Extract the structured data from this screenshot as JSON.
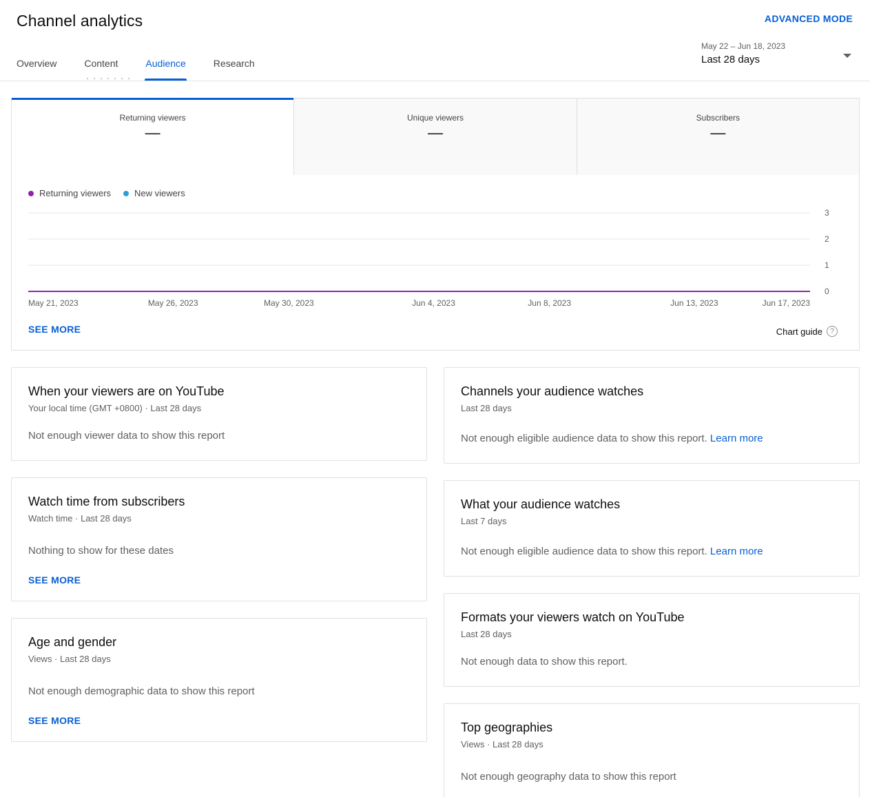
{
  "header": {
    "title": "Channel analytics",
    "advanced_mode": "ADVANCED MODE",
    "tabs": [
      "Overview",
      "Content",
      "Audience",
      "Research"
    ],
    "active_tab": "Audience",
    "date_range": "May 22 – Jun 18, 2023",
    "date_label": "Last 28 days"
  },
  "metrics": [
    {
      "label": "Returning viewers",
      "value": "—"
    },
    {
      "label": "Unique viewers",
      "value": "—"
    },
    {
      "label": "Subscribers",
      "value": "—"
    }
  ],
  "chart_data": {
    "type": "line",
    "title": "",
    "xlabel": "",
    "ylabel": "",
    "ylim": [
      0,
      3
    ],
    "y_ticks": [
      "3",
      "2",
      "1",
      "0"
    ],
    "x_tick_labels": [
      "May 21, 2023",
      "May 26, 2023",
      "May 30, 2023",
      "Jun 4, 2023",
      "Jun 8, 2023",
      "Jun 13, 2023",
      "Jun 17, 2023"
    ],
    "x_range": [
      "May 21, 2023",
      "Jun 17, 2023"
    ],
    "grid": true,
    "legend_position": "top-left",
    "series": [
      {
        "name": "Returning viewers",
        "color": "#8e24aa",
        "values": [
          0,
          0
        ]
      },
      {
        "name": "New viewers",
        "color": "#2aa1d8",
        "values": [
          0,
          0
        ]
      }
    ],
    "y_axis_side": "right"
  },
  "chart_footer": {
    "see_more": "SEE MORE",
    "chart_guide": "Chart guide",
    "help_glyph": "?"
  },
  "cards": {
    "when_viewers": {
      "title": "When your viewers are on YouTube",
      "subtitle": "Your local time (GMT +0800) · Last 28 days",
      "message": "Not enough viewer data to show this report"
    },
    "watch_time_subs": {
      "title": "Watch time from subscribers",
      "subtitle": "Watch time · Last 28 days",
      "message": "Nothing to show for these dates",
      "see_more": "SEE MORE"
    },
    "age_gender": {
      "title": "Age and gender",
      "subtitle": "Views · Last 28 days",
      "message": "Not enough demographic data to show this report",
      "see_more": "SEE MORE"
    },
    "channels_watched": {
      "title": "Channels your audience watches",
      "subtitle": "Last 28 days",
      "message": "Not enough eligible audience data to show this report.",
      "link": "Learn more"
    },
    "what_watched": {
      "title": "What your audience watches",
      "subtitle": "Last 7 days",
      "message": "Not enough eligible audience data to show this report.",
      "link": "Learn more"
    },
    "formats": {
      "title": "Formats your viewers watch on YouTube",
      "subtitle": "Last 28 days",
      "message": "Not enough data to show this report."
    },
    "geographies": {
      "title": "Top geographies",
      "subtitle": "Views · Last 28 days",
      "message": "Not enough geography data to show this report"
    }
  }
}
